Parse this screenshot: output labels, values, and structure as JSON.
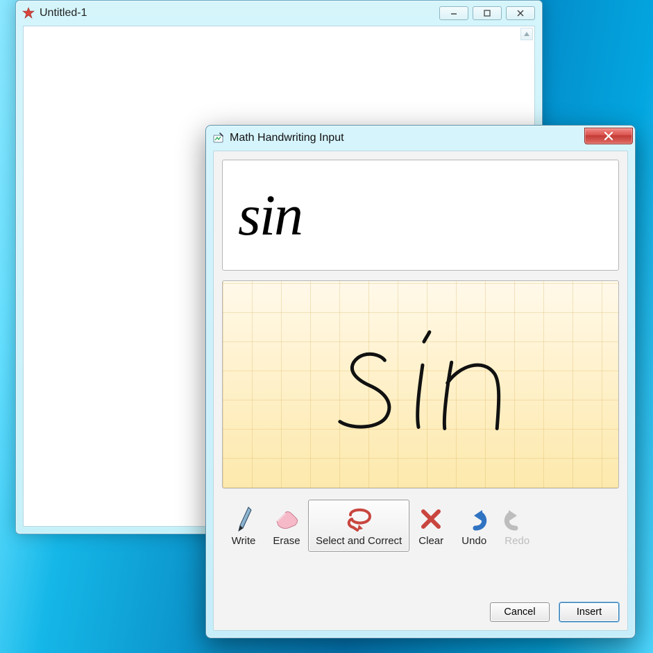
{
  "back_window": {
    "title": "Untitled-1",
    "app_icon": "mathematica-icon",
    "caption": {
      "minimize": "─",
      "maximize": "▢",
      "close": "✕"
    }
  },
  "front_window": {
    "title": "Math Handwriting Input",
    "app_icon": "ink-panel-icon",
    "close": "✕",
    "recognized_text": "sin",
    "handwritten_text": "sin",
    "tools": {
      "write": "Write",
      "erase": "Erase",
      "select_correct": "Select and Correct",
      "clear": "Clear",
      "undo": "Undo",
      "redo": "Redo"
    },
    "selected_tool": "select_correct",
    "disabled_tools": [
      "redo"
    ],
    "buttons": {
      "cancel": "Cancel",
      "insert": "Insert"
    }
  }
}
